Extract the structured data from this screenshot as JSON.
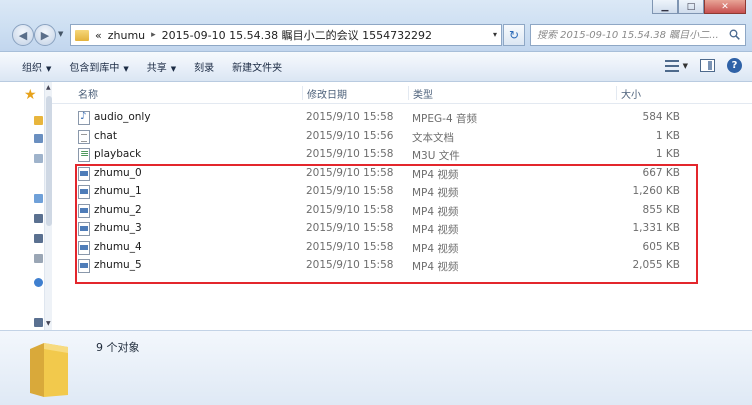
{
  "window": {
    "minimize_symbol": "▁",
    "maximize_symbol": "□",
    "close_symbol": "✕"
  },
  "address_bar": {
    "crumb_prefix": "«",
    "crumbs": [
      "zhumu",
      "2015-09-10 15.54.38 瞩目小二的会议 1554732292"
    ],
    "separator": "▸",
    "dropdown_symbol": "▾"
  },
  "search": {
    "placeholder": "搜索 2015-09-10 15.54.38 瞩目小二..."
  },
  "toolbar": {
    "items": [
      {
        "label": "组织",
        "has_dropdown": true
      },
      {
        "label": "包含到库中",
        "has_dropdown": true
      },
      {
        "label": "共享",
        "has_dropdown": true
      },
      {
        "label": "刻录",
        "has_dropdown": false
      },
      {
        "label": "新建文件夹",
        "has_dropdown": false
      }
    ],
    "dropdown_symbol": "▼",
    "help_label": "?"
  },
  "columns": {
    "name": "名称",
    "date": "修改日期",
    "type": "类型",
    "size": "大小"
  },
  "files": [
    {
      "name": "audio_only",
      "date": "2015/9/10 15:58",
      "type": "MPEG-4 音频",
      "size": "584 KB",
      "icon": "audio-file-icon"
    },
    {
      "name": "chat",
      "date": "2015/9/10 15:56",
      "type": "文本文档",
      "size": "1 KB",
      "icon": "text-file-icon"
    },
    {
      "name": "playback",
      "date": "2015/9/10 15:58",
      "type": "M3U 文件",
      "size": "1 KB",
      "icon": "playlist-file-icon"
    },
    {
      "name": "zhumu_0",
      "date": "2015/9/10 15:58",
      "type": "MP4 视频",
      "size": "667 KB",
      "icon": "video-file-icon"
    },
    {
      "name": "zhumu_1",
      "date": "2015/9/10 15:58",
      "type": "MP4 视频",
      "size": "1,260 KB",
      "icon": "video-file-icon"
    },
    {
      "name": "zhumu_2",
      "date": "2015/9/10 15:58",
      "type": "MP4 视频",
      "size": "855 KB",
      "icon": "video-file-icon"
    },
    {
      "name": "zhumu_3",
      "date": "2015/9/10 15:58",
      "type": "MP4 视频",
      "size": "1,331 KB",
      "icon": "video-file-icon"
    },
    {
      "name": "zhumu_4",
      "date": "2015/9/10 15:58",
      "type": "MP4 视频",
      "size": "605 KB",
      "icon": "video-file-icon"
    },
    {
      "name": "zhumu_5",
      "date": "2015/9/10 15:58",
      "type": "MP4 视频",
      "size": "2,055 KB",
      "icon": "video-file-icon"
    }
  ],
  "status": {
    "item_count": "9 个对象"
  },
  "colors": {
    "highlight_border": "#e3262c",
    "folder_yellow": "#f2c94c",
    "accent_blue": "#2f62a7"
  }
}
